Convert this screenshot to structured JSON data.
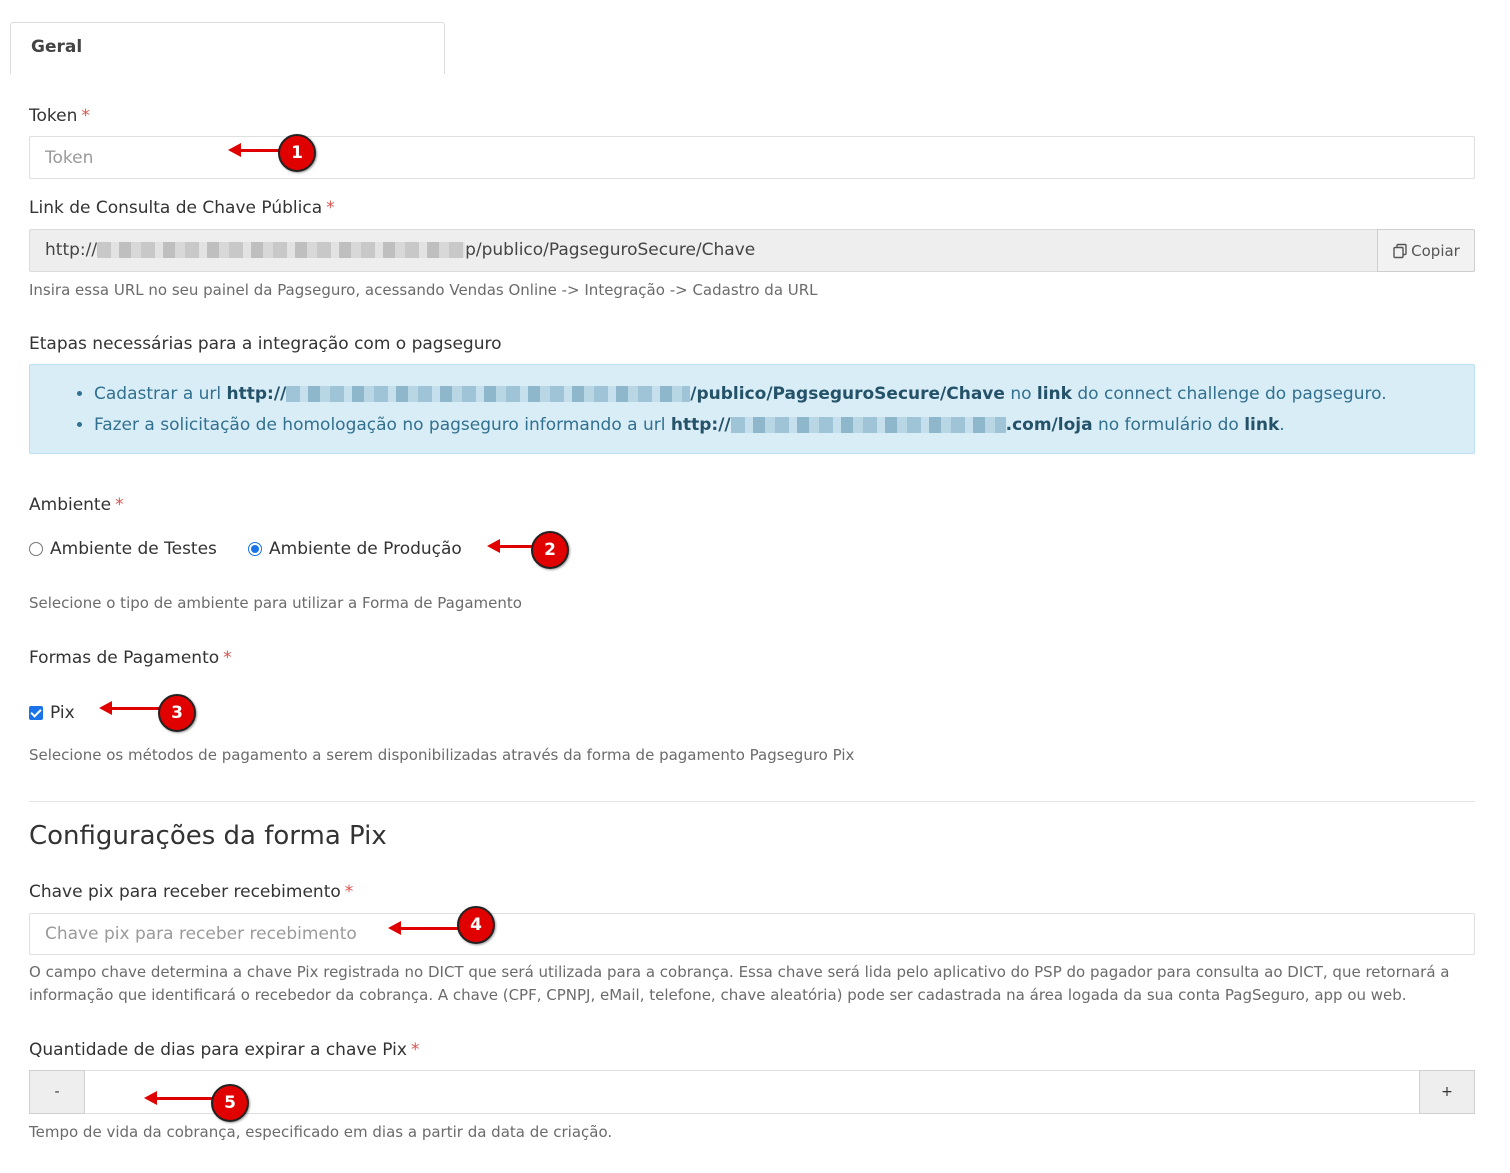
{
  "tabs": [
    {
      "label": "Geral"
    }
  ],
  "token": {
    "label": "Token",
    "placeholder": "Token",
    "value": ""
  },
  "public_key": {
    "label": "Link de Consulta de Chave Pública",
    "url_prefix": "http://",
    "url_suffix": "p/publico/PagseguroSecure/Chave",
    "copy_label": "Copiar",
    "help": "Insira essa URL no seu painel da Pagseguro, acessando Vendas Online -> Integração -> Cadastro da URL"
  },
  "steps": {
    "title": "Etapas necessárias para a integração com o pagseguro",
    "item1": {
      "before": "Cadastrar a url ",
      "url_prefix": "http://",
      "url_suffix": "/publico/PagseguroSecure/Chave",
      "middle": " no ",
      "link": "link",
      "after": " do connect challenge do pagseguro."
    },
    "item2": {
      "before": "Fazer a solicitação de homologação no pagseguro informando a url ",
      "url_prefix": "http://",
      "url_suffix": ".com/loja",
      "middle": " no formulário do ",
      "link": "link",
      "after": "."
    }
  },
  "environment": {
    "label": "Ambiente",
    "options": [
      "Ambiente de Testes",
      "Ambiente de Produção"
    ],
    "selected": "Ambiente de Produção",
    "help": "Selecione o tipo de ambiente para utilizar a Forma de Pagamento"
  },
  "payment_methods": {
    "label": "Formas de Pagamento",
    "options": [
      {
        "label": "Pix",
        "checked": true
      }
    ],
    "help": "Selecione os métodos de pagamento a serem disponibilizadas através da forma de pagamento Pagseguro Pix"
  },
  "pix_section": {
    "title": "Configurações da forma Pix",
    "key": {
      "label": "Chave pix para receber recebimento",
      "placeholder": "Chave pix para receber recebimento",
      "help_line1": "O campo chave determina a chave Pix registrada no DICT que será utilizada para a cobrança. Essa chave será lida pelo aplicativo do PSP do pagador para consulta ao DICT, que retornará a",
      "help_line2": "informação que identificará o recebedor da cobrança. A chave (CPF, CPNPJ, eMail, telefone, chave aleatória) pode ser cadastrada na área logada da sua conta PagSeguro, app ou web."
    },
    "expiry": {
      "label": "Quantidade de dias para expirar a chave Pix",
      "value": "",
      "minus_label": "-",
      "plus_label": "+",
      "help": "Tempo de vida da cobrança, especificado em dias a partir da data de criação."
    }
  },
  "annotations": [
    "1",
    "2",
    "3",
    "4",
    "5"
  ],
  "colors": {
    "required": "#d9534f",
    "annotation": "#e00000",
    "info_bg": "#d9edf7",
    "accent": "#1a73e8"
  }
}
